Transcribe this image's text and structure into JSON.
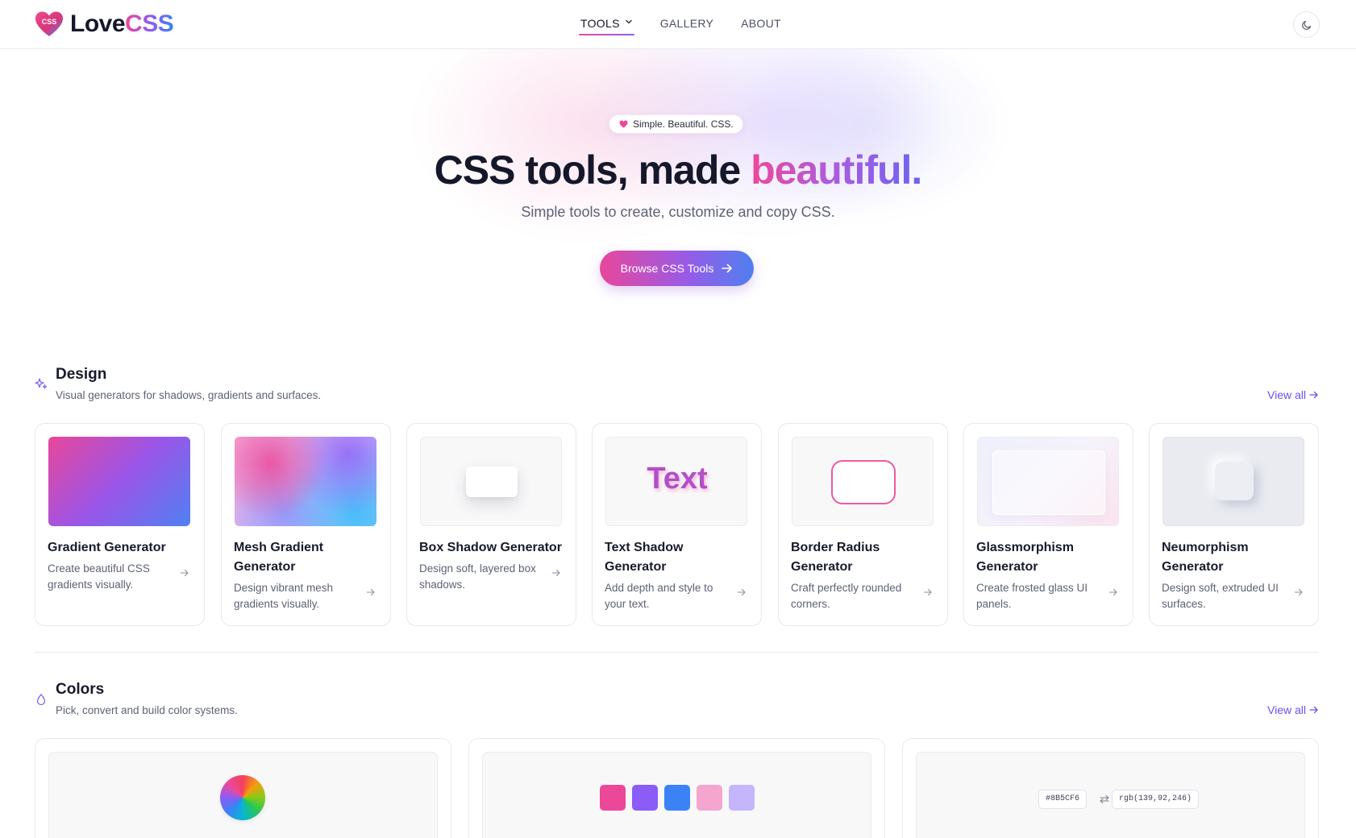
{
  "header": {
    "logo_badge": "CSS",
    "logo_word_1": "Love",
    "logo_word_2": "CSS",
    "nav": [
      {
        "label": "TOOLS",
        "active": true,
        "has_dropdown": true
      },
      {
        "label": "GALLERY",
        "active": false
      },
      {
        "label": "ABOUT",
        "active": false
      }
    ],
    "theme_toggle_icon": "moon-icon"
  },
  "hero": {
    "badge": "Simple. Beautiful. CSS.",
    "title_main": "CSS tools, made ",
    "title_accent": "beautiful.",
    "subtitle": "Simple tools to create, customize and copy CSS.",
    "cta_label": "Browse CSS Tools"
  },
  "sections": {
    "design": {
      "icon": "sparkles-icon",
      "title": "Design",
      "description": "Visual generators for shadows, gradients and surfaces.",
      "view_all": "View all",
      "cards": [
        {
          "title": "Gradient Generator",
          "description": "Create beautiful CSS gradients visually."
        },
        {
          "title": "Mesh Gradient Generator",
          "description": "Design vibrant mesh gradients visually."
        },
        {
          "title": "Box Shadow Generator",
          "description": "Design soft, layered box shadows."
        },
        {
          "title": "Text Shadow Generator",
          "description": "Add depth and style to your text.",
          "preview_text": "Text"
        },
        {
          "title": "Border Radius Generator",
          "description": "Craft perfectly rounded corners."
        },
        {
          "title": "Glassmorphism Generator",
          "description": "Create frosted glass UI panels."
        },
        {
          "title": "Neumorphism Generator",
          "description": "Design soft, extruded UI surfaces."
        }
      ]
    },
    "colors": {
      "icon": "droplet-icon",
      "title": "Colors",
      "description": "Pick, convert and build color systems.",
      "view_all": "View all",
      "palette_swatches": [
        "#ec4899",
        "#8b5cf6",
        "#3b82f6",
        "#f4a6cf",
        "#c4b5fd"
      ],
      "converter_hex": "#8B5CF6",
      "converter_rgb": "rgb(139,92,246)"
    }
  },
  "colors": {
    "accent_pink": "#ec4899",
    "accent_purple": "#8b5cf6",
    "accent_blue": "#3b82f6",
    "link": "#6d4ef0"
  }
}
